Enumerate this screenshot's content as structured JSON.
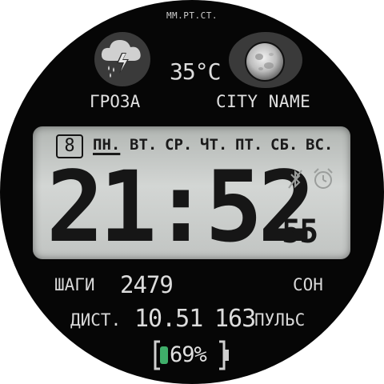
{
  "header": {
    "pressure_unit": "ММ.РТ.СТ."
  },
  "weather": {
    "icon": "thunderstorm-icon",
    "temperature": "35°C",
    "condition": "ГРОЗА",
    "city": "CITY NAME",
    "moon_icon": "moon-icon"
  },
  "lcd": {
    "day_number": "8",
    "weekdays": [
      "ПН.",
      "ВТ.",
      "СР.",
      "ЧТ.",
      "ПТ.",
      "СБ.",
      "ВС."
    ],
    "active_weekday": "ПН.",
    "time": "21:52",
    "seconds": "55",
    "icons": [
      "bluetooth-off-icon",
      "alarm-icon"
    ]
  },
  "stats": {
    "steps_label": "ШАГИ",
    "steps_value": "2479",
    "sleep_label": "СОН",
    "distance_label": "ДИСТ.",
    "distance_value": "10.51",
    "heart_rate_value": "163",
    "heart_rate_label": "ПУЛЬС",
    "battery_value": "69%",
    "battery_level_percent": 69
  },
  "colors": {
    "face_bg": "#060606",
    "lcd_bg": "#c8cbc9",
    "text_light": "#d8d8d8",
    "lcd_text": "#141414",
    "battery_fill": "#3fae6a"
  }
}
